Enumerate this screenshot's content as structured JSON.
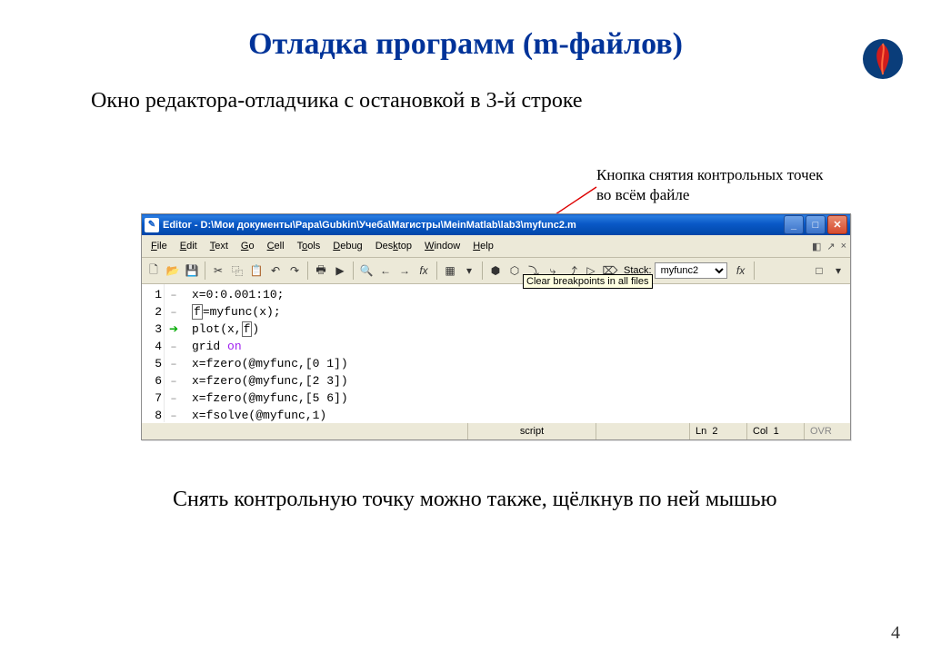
{
  "slide": {
    "title": "Отладка программ (m-файлов)",
    "subtitle": "Окно редактора-отладчика с остановкой в 3-й строке",
    "annotation1": "Кнопка снятия контрольных точек",
    "annotation2": "во всём файле",
    "footer": "Снять контрольную точку можно также, щёлкнув по ней мышью",
    "page": "4"
  },
  "window": {
    "title": "Editor - D:\\Мои документы\\Papa\\Gubkin\\Учеба\\Магистры\\MeinMatlab\\lab3\\myfunc2.m",
    "tooltip": "Clear breakpoints in all files",
    "stack_label": "Stack:",
    "stack_value": "myfunc2",
    "status": {
      "mode": "script",
      "ln_label": "Ln",
      "ln": "2",
      "col_label": "Col",
      "col": "1",
      "ovr": "OVR"
    }
  },
  "menus": [
    "File",
    "Edit",
    "Text",
    "Go",
    "Cell",
    "Tools",
    "Debug",
    "Desktop",
    "Window",
    "Help"
  ],
  "gutter": [
    "1",
    "2",
    "3",
    "4",
    "5",
    "6",
    "7",
    "8"
  ],
  "code": {
    "l1": "x=0:0.001:10;",
    "l2a": "f",
    "l2b": "=myfunc(x);",
    "l3a": "plot(x,",
    "l3b": "f",
    "l3c": ")",
    "l4a": "grid ",
    "l4b": "on",
    "l5": "x=fzero(@myfunc,[0 1])",
    "l6": "x=fzero(@myfunc,[2 3])",
    "l7": "x=fzero(@myfunc,[5 6])",
    "l8": "x=fsolve(@myfunc,1)"
  }
}
